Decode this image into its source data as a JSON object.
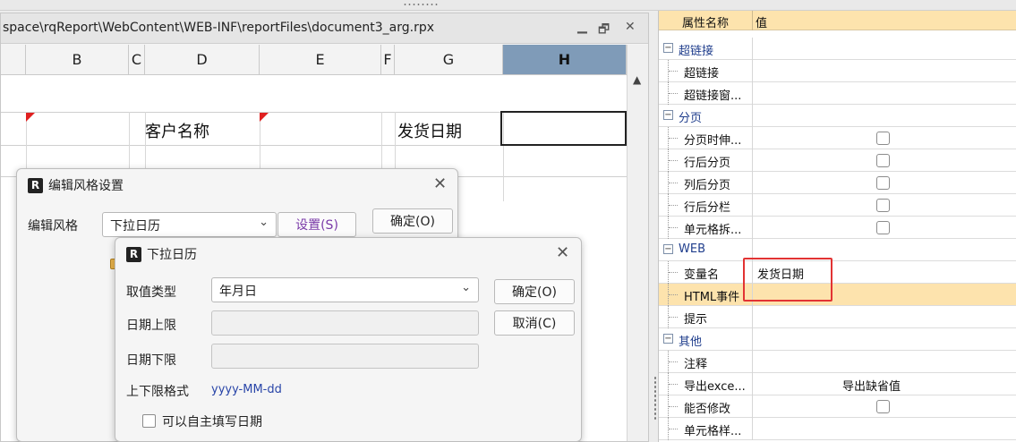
{
  "editor": {
    "path": "space\\rqReport\\WebContent\\WEB-INF\\reportFiles\\document3_arg.rpx",
    "columns": [
      "B",
      "C",
      "D",
      "E",
      "F",
      "G",
      "H"
    ],
    "cells": {
      "d_header": "客户名称",
      "g_header": "发货日期"
    }
  },
  "style_dialog": {
    "title": "编辑风格设置",
    "label": "编辑风格",
    "selected": "下拉日历",
    "settings_button": "设置(S)",
    "ok_button": "确定(O)"
  },
  "calendar_dialog": {
    "title": "下拉日历",
    "value_type_label": "取值类型",
    "value_type_selected": "年月日",
    "upper_label": "日期上限",
    "lower_label": "日期下限",
    "format_label": "上下限格式",
    "format_value": "yyyy-MM-dd",
    "checkbox_label": "可以自主填写日期",
    "ok_button": "确定(O)",
    "cancel_button": "取消(C)"
  },
  "props": {
    "header_name": "属性名称",
    "header_value": "值",
    "rows": [
      {
        "name": "超链接",
        "type": "group"
      },
      {
        "name": "超链接",
        "type": "item"
      },
      {
        "name": "超链接窗...",
        "type": "item"
      },
      {
        "name": "分页",
        "type": "group"
      },
      {
        "name": "分页时伸...",
        "type": "check"
      },
      {
        "name": "行后分页",
        "type": "check"
      },
      {
        "name": "列后分页",
        "type": "check"
      },
      {
        "name": "行后分栏",
        "type": "check"
      },
      {
        "name": "单元格拆...",
        "type": "check"
      },
      {
        "name": "WEB",
        "type": "group"
      },
      {
        "name": "变量名",
        "type": "item",
        "value": "发货日期"
      },
      {
        "name": "HTML事件",
        "type": "hl"
      },
      {
        "name": "提示",
        "type": "item"
      },
      {
        "name": "其他",
        "type": "group"
      },
      {
        "name": "注释",
        "type": "item"
      },
      {
        "name": "导出exce...",
        "type": "item",
        "value": "导出缺省值"
      },
      {
        "name": "能否修改",
        "type": "check"
      },
      {
        "name": "单元格样...",
        "type": "item"
      }
    ]
  }
}
